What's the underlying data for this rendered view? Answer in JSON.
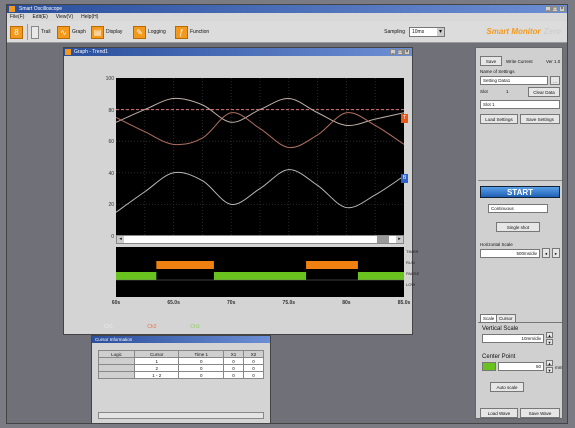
{
  "window": {
    "title": "Smart Oscilloscope"
  },
  "menu": [
    "File(F)",
    "Edit(E)",
    "View(V)",
    "Help(H)"
  ],
  "toolbar": {
    "items": [
      {
        "icon": "panel-icon",
        "label": ""
      },
      {
        "icon": "trail-icon",
        "label": "Trail"
      },
      {
        "icon": "graph-icon",
        "label": "Graph"
      },
      {
        "icon": "display-icon",
        "label": "Display"
      },
      {
        "icon": "logging-icon",
        "label": "Logging"
      },
      {
        "icon": "function-icon",
        "label": "Function"
      }
    ],
    "speed_label": "Sampling",
    "speed_value": "10ms",
    "brand_main": "Smart Monitor",
    "brand_sub": "Zero"
  },
  "graph": {
    "title": "Graph - Trend1",
    "yticks": [
      "100",
      "80",
      "60",
      "40",
      "20",
      "0"
    ],
    "xticks": [
      "60s",
      "65.0s",
      "70s",
      "75.0s",
      "80s",
      "85.0s"
    ],
    "digital_labels": [
      "TIMER",
      "RUN",
      "PAUSE",
      "LOW"
    ],
    "legend": [
      "Ch1",
      "Ch2",
      "Ch3"
    ],
    "markers": [
      {
        "label": "T",
        "color": "#e6571a"
      },
      {
        "label": "B",
        "color": "#2f62c9"
      }
    ],
    "colors": {
      "ch1": "#c0b0a8",
      "ch2": "#b07060",
      "ch3": "#b8b8b8",
      "threshold": "#e0707a",
      "digital_high": "#f08010",
      "digital_low": "#6ac21e"
    }
  },
  "chart_data": {
    "type": "line",
    "x": [
      60,
      62.5,
      65,
      67.5,
      70,
      72.5,
      75,
      77.5,
      80,
      82.5,
      85
    ],
    "ylim": [
      0,
      100
    ],
    "xlim": [
      60,
      85
    ],
    "series": [
      {
        "values": [
          72,
          80,
          87,
          83,
          72,
          80,
          87,
          78,
          70,
          74,
          78
        ]
      },
      {
        "values": [
          75,
          66,
          58,
          62,
          78,
          68,
          56,
          64,
          78,
          70,
          58
        ]
      },
      {
        "values": [
          15,
          28,
          40,
          35,
          20,
          30,
          42,
          32,
          18,
          26,
          38
        ]
      }
    ],
    "threshold": 80,
    "digital": {
      "high": [
        [
          63.5,
          68.5
        ],
        [
          76.5,
          81
        ]
      ],
      "low": [
        [
          60,
          63.5
        ],
        [
          68.5,
          76.5
        ],
        [
          81,
          85
        ]
      ]
    }
  },
  "side": {
    "save_btn": "Save",
    "mode_label": "Write Current",
    "mode_value": "Ver 1.0",
    "name_label": "Name of Settings",
    "name_value": "Setting Data1",
    "slot_label": "Slot",
    "slot_value": "1",
    "clear_btn": "Clear Data",
    "select_value": "Slot 1",
    "load_btn": "Load Settings",
    "save_settings_btn": "Save Settings",
    "start_btn": "START",
    "trigger_value": "Continuous",
    "single_btn": "Single shot",
    "hscale_label": "Horizontal Scale",
    "hscale_value": "500ms/div",
    "tabs": [
      "Scale",
      "Cursor"
    ],
    "vscale_label": "Vertical Scale",
    "vscale_value": "10mm/div",
    "center_label": "Center Point",
    "center_value": "50",
    "center_unit": "mm",
    "auto_btn": "Auto scale",
    "load_wave_btn": "Load Wave",
    "save_wave_btn": "Save Wave"
  },
  "cursor": {
    "title": "Cursor Information",
    "headers": [
      "Logic",
      "Cursor",
      "Time 1",
      "X1",
      "X2"
    ],
    "rows": [
      [
        "",
        "1",
        "0",
        "0",
        "0"
      ],
      [
        "",
        "2",
        "0",
        "0",
        "0"
      ],
      [
        "",
        "1 - 2",
        "0",
        "0",
        "0"
      ]
    ]
  }
}
